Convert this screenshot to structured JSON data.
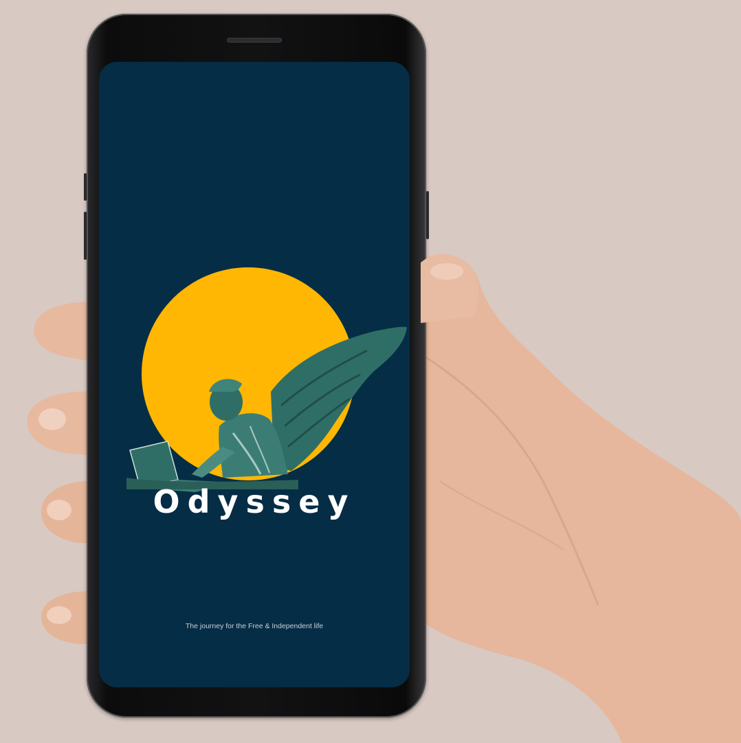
{
  "app": {
    "title": "Odyssey",
    "tagline": "The journey for the Free & Independent life"
  },
  "icons": {
    "logo": "angel-with-laptop-icon"
  },
  "colors": {
    "backdrop": "#d8c9c3",
    "screen_background": "#052d45",
    "sun": "#ffb703",
    "statue": "#2f6e66",
    "title_text": "#ffffff"
  }
}
